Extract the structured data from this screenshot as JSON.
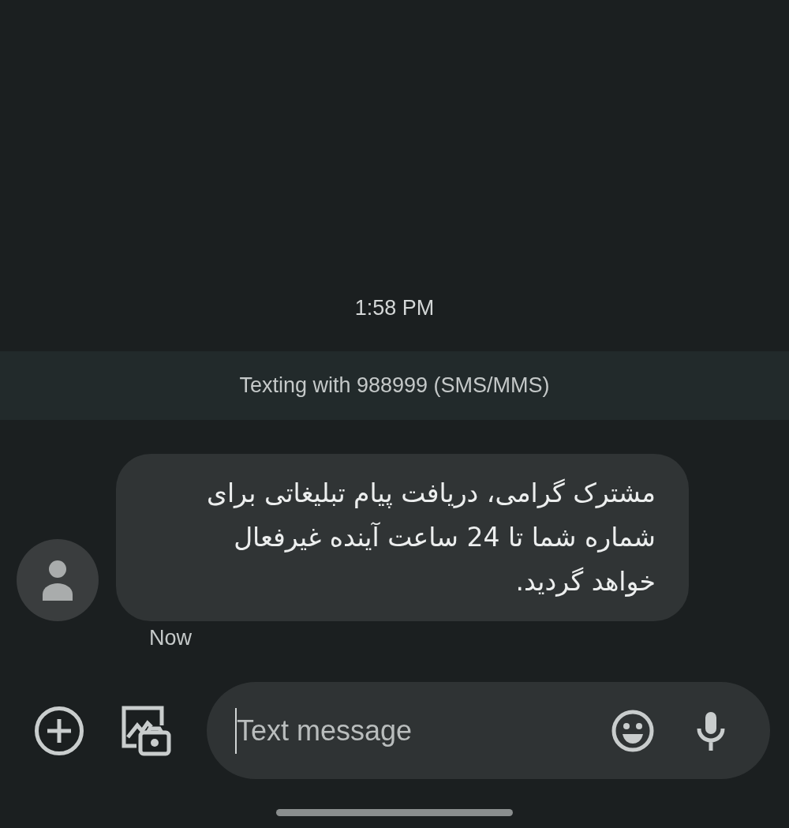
{
  "timestamp": "1:58 PM",
  "banner": "Texting with 988999 (SMS/MMS)",
  "messages": [
    {
      "text": "مشترک گرامی، دریافت پیام تبلیغاتی برای شماره شما تا 24 ساعت آینده غیرفعال خواهد گردید.",
      "time": "Now"
    }
  ],
  "composer": {
    "placeholder": "Text message"
  }
}
